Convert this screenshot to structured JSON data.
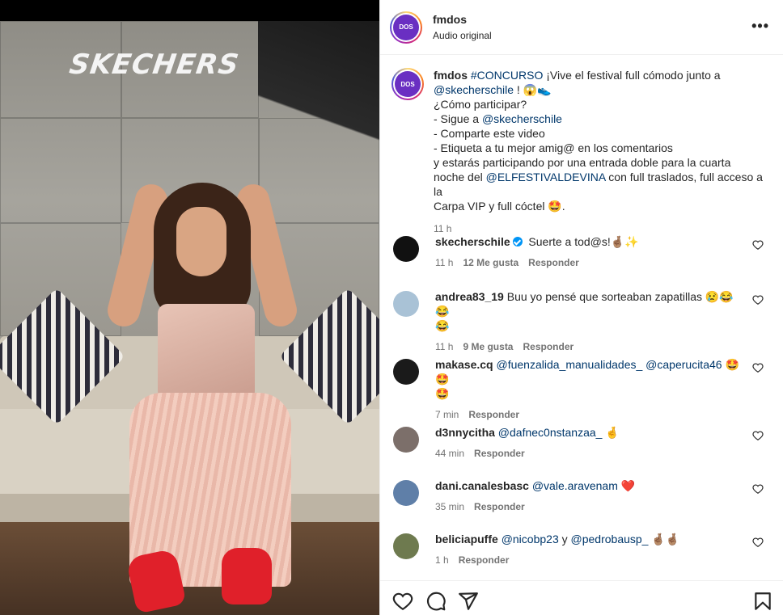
{
  "brand_logo": "SKECHERS",
  "header": {
    "username": "fmdos",
    "subtitle": "Audio original",
    "avatar_label": "DOS",
    "more_icon": "more-horizontal-icon"
  },
  "caption": {
    "username": "fmdos",
    "hashtag": "#CONCURSO",
    "text1": " ¡Vive el festival full cómodo junto a",
    "mention1": "@skecherschile",
    "text2": " ! 😱👟",
    "line_how": "¿Cómo participar?",
    "line_follow_prefix": "- Sigue a ",
    "mention_follow": "@skecherschile",
    "line_share": "- Comparte este video",
    "line_tag": "- Etiqueta a tu mejor amig@ en los comentarios",
    "line_part": "y estarás participando por una entrada doble para la cuarta",
    "line_night_prefix": "noche del ",
    "mention_festival": "@ELFESTIVALDEVINA",
    "line_night_suffix": " con full traslados, full acceso a la",
    "line_last": "Carpa VIP y full cóctel 🤩.",
    "time": "11 h"
  },
  "comments": [
    {
      "username": "skecherschile",
      "verified": true,
      "mentions": "",
      "text": "Suerte a tod@s!🤞🏽✨",
      "time": "11 h",
      "likes": "12 Me gusta",
      "reply": "Responder",
      "avatar_color": "#111111"
    },
    {
      "username": "andrea83_19",
      "verified": false,
      "mentions": "",
      "text": "Buu yo pensé que sorteaban zapatillas 😢😂😂",
      "text_line2": "😂",
      "time": "11 h",
      "likes": "9 Me gusta",
      "reply": "Responder",
      "avatar_color": "#a9c2d6"
    },
    {
      "username": "makase.cq",
      "verified": false,
      "mentions": "@fuenzalida_manualidades_ @caperucita46",
      "text": " 🤩🤩",
      "text_line2": "🤩",
      "time": "7 min",
      "likes": "",
      "reply": "Responder",
      "avatar_color": "#1a1a1a"
    },
    {
      "username": "d3nnycitha",
      "verified": false,
      "mentions": "@dafnec0nstanzaa_",
      "text": " 🤞",
      "time": "44 min",
      "likes": "",
      "reply": "Responder",
      "avatar_color": "#7c6f6a"
    },
    {
      "username": "dani.canalesbasc",
      "verified": false,
      "mentions": "@vale.aravenam",
      "text": " ❤️",
      "time": "35 min",
      "likes": "",
      "reply": "Responder",
      "avatar_color": "#5f7fa8"
    },
    {
      "username": "beliciapuffe",
      "verified": false,
      "mentions": "@nicobp23",
      "text_mid": " y ",
      "mentions2": "@pedrobausp_",
      "text": " 🤞🏽🤞🏽",
      "time": "1 h",
      "likes": "",
      "reply": "Responder",
      "avatar_color": "#6e7a4f"
    }
  ],
  "actions": {
    "like_icon": "heart-icon",
    "comment_icon": "comment-icon",
    "share_icon": "send-icon",
    "save_icon": "bookmark-icon"
  },
  "colors": {
    "link": "#00376b",
    "muted": "#737373",
    "verified": "#0095f6",
    "heart": "#e0245e"
  }
}
